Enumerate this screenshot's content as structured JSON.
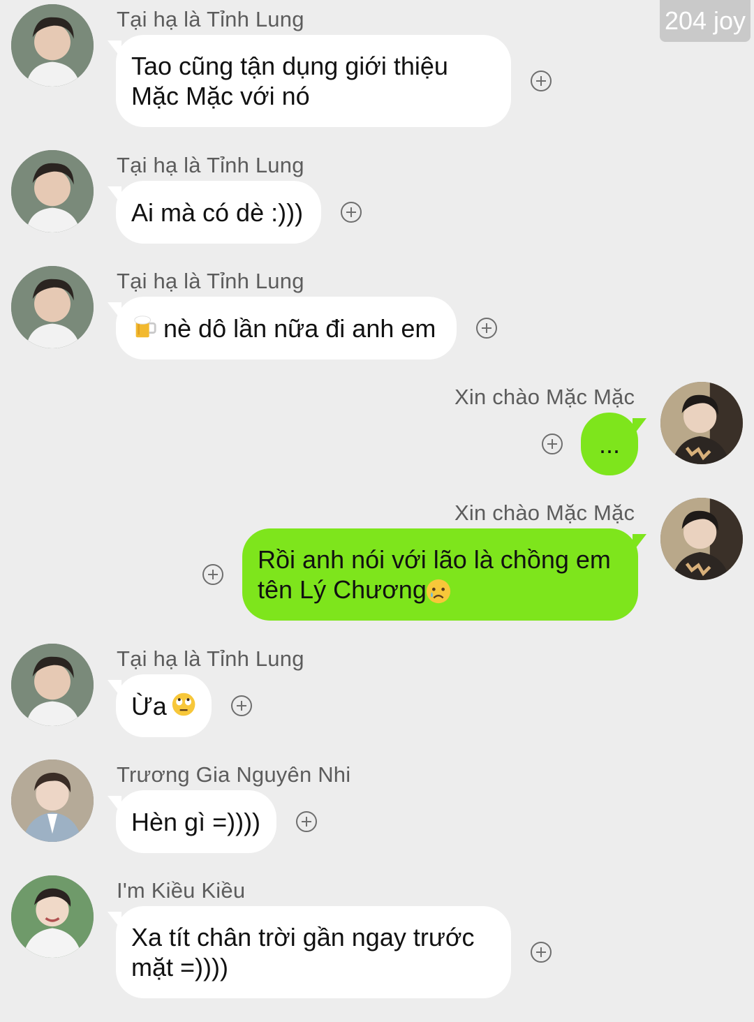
{
  "watermark": "204 joy",
  "colors": {
    "background": "#ededed",
    "incoming_bubble": "#ffffff",
    "outgoing_bubble": "#7ee51c"
  },
  "messages": [
    {
      "sender": "Tại hạ là Tỉnh Lung",
      "direction": "incoming",
      "text": "Tao cũng tận dụng giới thiệu\nMặc Mặc với nó"
    },
    {
      "sender": "Tại hạ là Tỉnh Lung",
      "direction": "incoming",
      "text": "Ai mà có dè :)))"
    },
    {
      "sender": "Tại hạ là Tỉnh Lung",
      "direction": "incoming",
      "text": "nè dô lần nữa đi anh em",
      "emoji_before": "beer-mug-emoji"
    },
    {
      "sender": "Xin chào Mặc Mặc",
      "direction": "outgoing",
      "text": "..."
    },
    {
      "sender": "Xin chào Mặc Mặc",
      "direction": "outgoing",
      "text": "Rồi anh nói với lão là chồng em\ntên Lý Chương",
      "emoji_after": "crying-face-emoji"
    },
    {
      "sender": "Tại hạ là Tỉnh Lung",
      "direction": "incoming",
      "text": "Ừa",
      "emoji_after": "eye-roll-emoji"
    },
    {
      "sender": "Trương Gia Nguyên Nhi",
      "direction": "incoming",
      "text": "Hèn gì =))))"
    },
    {
      "sender": "I'm Kiều Kiều",
      "direction": "incoming",
      "text": "Xa tít chân trời gần ngay trước\nmặt =))))"
    }
  ]
}
